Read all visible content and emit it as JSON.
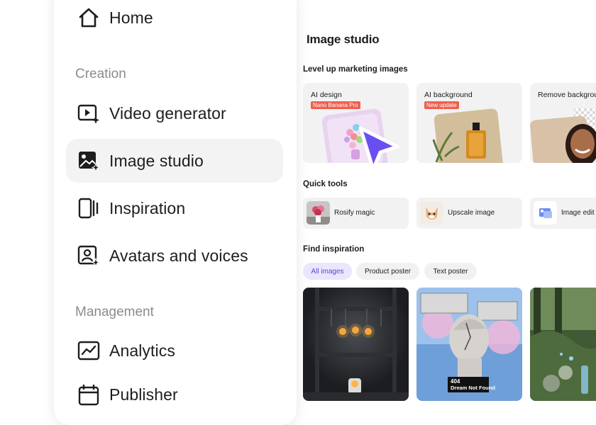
{
  "sidebar": {
    "home_label": "Home",
    "creation_title": "Creation",
    "items": [
      {
        "label": "Video generator",
        "icon": "video-sparkle-icon"
      },
      {
        "label": "Image studio",
        "icon": "image-sparkle-icon",
        "active": true
      },
      {
        "label": "Inspiration",
        "icon": "columns-icon"
      },
      {
        "label": "Avatars and voices",
        "icon": "avatar-sparkle-icon"
      }
    ],
    "management_title": "Management",
    "management_items": [
      {
        "label": "Analytics",
        "icon": "chart-icon"
      },
      {
        "label": "Publisher",
        "icon": "calendar-icon"
      }
    ]
  },
  "main": {
    "title": "Image studio",
    "marketing_title": "Level up marketing images",
    "cards": [
      {
        "title": "AI design",
        "badge": "Nano Banana Pro"
      },
      {
        "title": "AI background",
        "badge": "New update"
      },
      {
        "title": "Remove backgrou"
      }
    ],
    "quick_title": "Quick tools",
    "tools": [
      {
        "label": "Rosify magic"
      },
      {
        "label": "Upscale image"
      },
      {
        "label": "Image edit"
      }
    ],
    "inspiration_title": "Find inspiration",
    "chips": [
      {
        "label": "All images",
        "selected": true
      },
      {
        "label": "Product poster"
      },
      {
        "label": "Text poster"
      }
    ],
    "gallery_overlay_1": "404",
    "gallery_overlay_2": "Dream Not Found"
  },
  "colors": {
    "accent": "#6b4ef2",
    "badge": "#ef5e4e",
    "chip_selected_bg": "#e9e7fd"
  }
}
